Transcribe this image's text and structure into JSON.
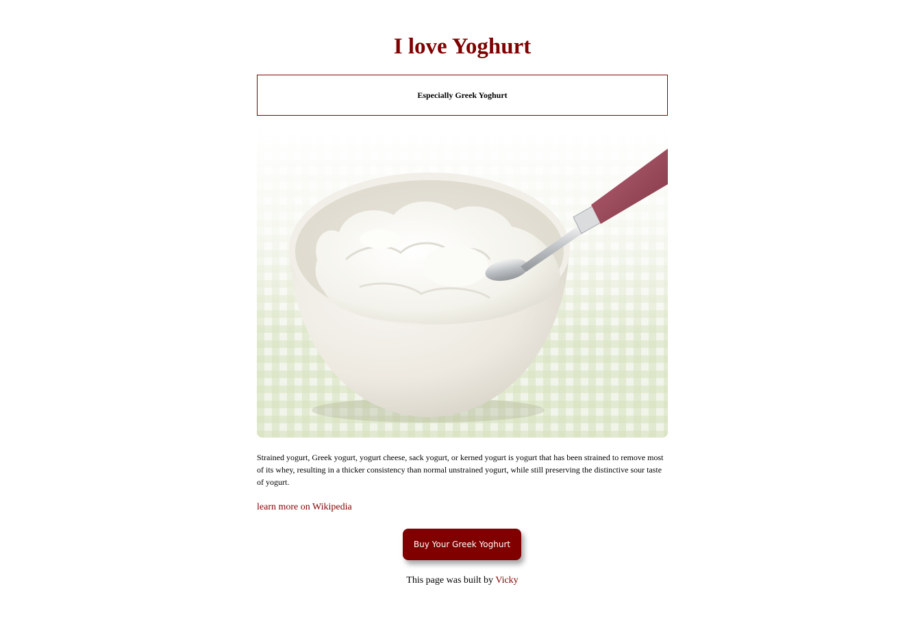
{
  "page": {
    "title": "I love Yoghurt",
    "subtitle": "Especially Greek Yoghurt",
    "description": "Strained yogurt, Greek yogurt, yogurt cheese, sack yogurt, or kerned yogurt is yogurt that has been strained to remove most of its whey, resulting in a thicker consistency than normal unstrained yogurt, while still preserving the distinctive sour taste of yogurt.",
    "wiki_link_label": "learn more on Wikipedia",
    "buy_button_label": "Buy Your Greek Yoghurt",
    "footer_prefix": "This page was built by",
    "footer_author": "Vicky"
  },
  "image": {
    "subject": "bowl of greek yoghurt with spoon"
  },
  "colors": {
    "accent": "#800000",
    "background": "#ffffff",
    "text": "#000000"
  }
}
